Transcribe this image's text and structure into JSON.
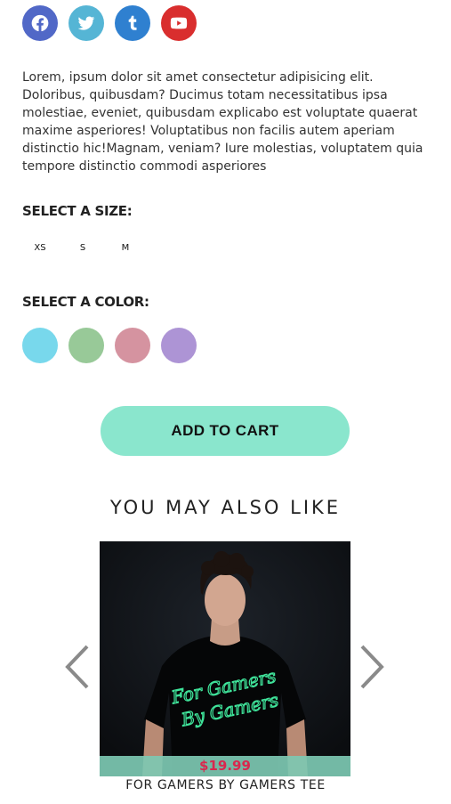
{
  "social": [
    {
      "name": "facebook-icon",
      "color": "#5168c7"
    },
    {
      "name": "twitter-icon",
      "color": "#55b5d5"
    },
    {
      "name": "tumblr-icon",
      "color": "#2f80d0"
    },
    {
      "name": "youtube-icon",
      "color": "#d92e2e"
    }
  ],
  "description": "Lorem, ipsum dolor sit amet consectetur adipisicing elit. Doloribus, quibusdam? Ducimus totam necessitatibus ipsa molestiae, eveniet, quibusdam explicabo est voluptate quaerat maxime asperiores! Voluptatibus non facilis autem aperiam distinctio hic!Magnam, veniam? Iure molestias, voluptatem quia tempore distinctio commodi asperiores",
  "size_section": {
    "label": "SELECT A SIZE:",
    "options": [
      "XS",
      "S",
      "M"
    ]
  },
  "color_section": {
    "label": "SELECT A COLOR:",
    "swatches": [
      "#78d8ec",
      "#98c998",
      "#d593a0",
      "#ad94d5"
    ]
  },
  "cart_button": {
    "label": "ADD TO CART",
    "color": "#8ae6cd"
  },
  "recommendations": {
    "heading": "YOU MAY ALSO LIKE",
    "product": {
      "price": "$19.99",
      "price_color": "#d9284e",
      "name": "FOR GAMERS BY GAMERS TEE",
      "shirt_text_line1": "For Gamers",
      "shirt_text_line2": "By Gamers"
    },
    "prev_icon": "chevron-left-icon",
    "next_icon": "chevron-right-icon"
  }
}
